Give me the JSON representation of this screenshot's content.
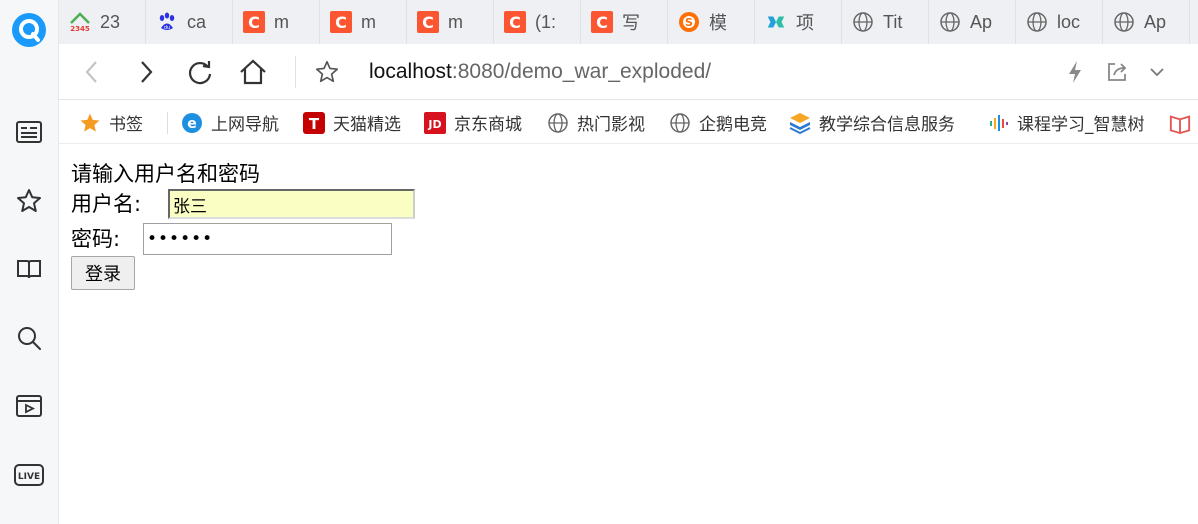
{
  "tabs": [
    {
      "title": "23",
      "icon": "2345-icon"
    },
    {
      "title": "ca",
      "icon": "baidu-paw-icon"
    },
    {
      "title": "m",
      "icon": "csdn-icon"
    },
    {
      "title": "m",
      "icon": "csdn-icon"
    },
    {
      "title": "m",
      "icon": "csdn-icon"
    },
    {
      "title": "(1:",
      "icon": "csdn-icon"
    },
    {
      "title": "写",
      "icon": "csdn-icon"
    },
    {
      "title": "模",
      "icon": "sogou-icon"
    },
    {
      "title": "项",
      "icon": "project-icon"
    },
    {
      "title": "Tit",
      "icon": "globe-icon"
    },
    {
      "title": "Ap",
      "icon": "globe-icon"
    },
    {
      "title": "loc",
      "icon": "globe-icon"
    },
    {
      "title": "Ap",
      "icon": "globe-icon"
    }
  ],
  "address": {
    "host": "localhost",
    "path": ":8080/demo_war_exploded/"
  },
  "bookmarks": [
    {
      "label": "书签",
      "icon": "star-icon"
    },
    {
      "label": "上网导航",
      "icon": "ie-icon"
    },
    {
      "label": "天猫精选",
      "icon": "tmall-icon"
    },
    {
      "label": "京东商城",
      "icon": "jd-icon"
    },
    {
      "label": "热门影视",
      "icon": "globe-icon"
    },
    {
      "label": "企鹅电竞",
      "icon": "globe-icon"
    },
    {
      "label": "教学综合信息服务",
      "icon": "jiaowu-icon"
    },
    {
      "label": "课程学习_智慧树",
      "icon": "zhihuishu-icon"
    }
  ],
  "page": {
    "title": "请输入用户名和密码",
    "username_label": "用户名:",
    "username_value": "张三",
    "password_label": "密码:",
    "password_value": "••••••",
    "login_label": "登录"
  },
  "colors": {
    "csdn": "#fc5531",
    "accent": "#1a9bfc",
    "autofill": "#fbfec3"
  }
}
